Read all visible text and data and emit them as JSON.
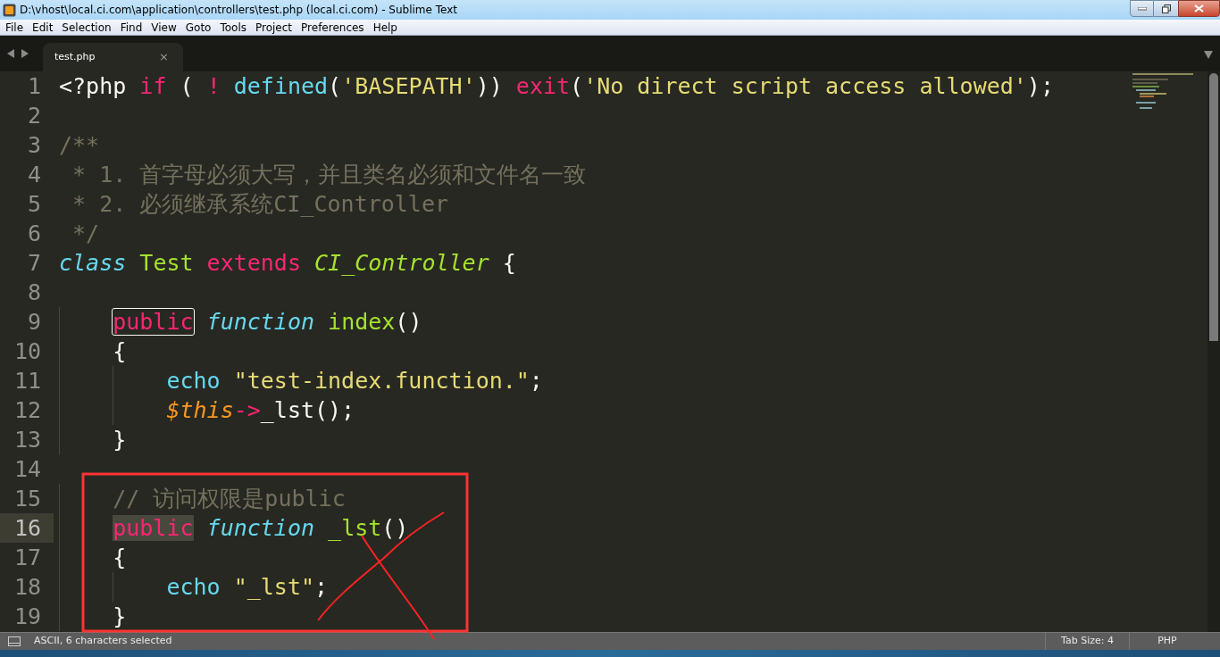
{
  "window": {
    "title": "D:\\vhost\\local.ci.com\\application\\controllers\\test.php (local.ci.com) - Sublime Text"
  },
  "menu": [
    "File",
    "Edit",
    "Selection",
    "Find",
    "View",
    "Goto",
    "Tools",
    "Project",
    "Preferences",
    "Help"
  ],
  "tabs": [
    {
      "label": "test.php",
      "selected": true,
      "close": "×"
    }
  ],
  "lines": [
    {
      "number": "1",
      "current": false,
      "tokens": [
        {
          "text": "<?php",
          "kind": "plain"
        },
        {
          "text": " if",
          "kind": "keyword"
        },
        {
          "text": " (",
          "kind": "plain"
        },
        {
          "text": " !",
          "kind": "keyword"
        },
        {
          "text": " defined",
          "kind": "builtin"
        },
        {
          "text": "(",
          "kind": "plain"
        },
        {
          "text": "'BASEPATH'",
          "kind": "string"
        },
        {
          "text": "))",
          "kind": "plain"
        },
        {
          "text": " exit",
          "kind": "keyword"
        },
        {
          "text": "(",
          "kind": "plain"
        },
        {
          "text": "'No direct script access allowed'",
          "kind": "string"
        },
        {
          "text": ");",
          "kind": "plain"
        }
      ]
    },
    {
      "number": "2",
      "current": false
    },
    {
      "number": "3",
      "current": false,
      "tokens": [
        {
          "text": "/**",
          "kind": "comment"
        }
      ]
    },
    {
      "number": "4",
      "current": false,
      "tokens": [
        {
          "text": " * 1. 首字母必须大写，并且类名必须和文件名一致",
          "kind": "comment"
        }
      ]
    },
    {
      "number": "5",
      "current": false,
      "tokens": [
        {
          "text": " * 2. 必须继承系统CI_Controller",
          "kind": "comment"
        }
      ]
    },
    {
      "number": "6",
      "current": false,
      "tokens": [
        {
          "text": " */",
          "kind": "comment"
        }
      ]
    },
    {
      "number": "7",
      "current": false,
      "tokens": [
        {
          "text": "class",
          "kind": "storage"
        },
        {
          "text": " Test",
          "kind": "entity"
        },
        {
          "text": " extends",
          "kind": "keyword"
        },
        {
          "text": " CI_Controller",
          "kind": "inherited"
        },
        {
          "text": " {",
          "kind": "plain"
        }
      ]
    },
    {
      "number": "8",
      "current": false
    },
    {
      "number": "9",
      "current": false,
      "tokens": [
        {
          "text": "    public",
          "kind": "keyword",
          "selected": false,
          "outlined": true
        },
        {
          "text": " function",
          "kind": "storage"
        },
        {
          "text": " index",
          "kind": "entity"
        },
        {
          "text": "()",
          "kind": "plain"
        }
      ]
    },
    {
      "number": "10",
      "current": false,
      "tokens": [
        {
          "text": "    {",
          "kind": "plain"
        }
      ]
    },
    {
      "number": "11",
      "current": false,
      "tokens": [
        {
          "text": "        echo",
          "kind": "builtin"
        },
        {
          "text": " \"test-index.function.\"",
          "kind": "string"
        },
        {
          "text": ";",
          "kind": "plain"
        }
      ]
    },
    {
      "number": "12",
      "current": false,
      "tokens": [
        {
          "text": "        $this",
          "kind": "variable"
        },
        {
          "text": "->",
          "kind": "keyword"
        },
        {
          "text": "_lst",
          "kind": "plain"
        },
        {
          "text": "();",
          "kind": "plain"
        }
      ]
    },
    {
      "number": "13",
      "current": false,
      "tokens": [
        {
          "text": "    }",
          "kind": "plain"
        }
      ]
    },
    {
      "number": "14",
      "current": false
    },
    {
      "number": "15",
      "current": false,
      "tokens": [
        {
          "text": "    // 访问权限是public",
          "kind": "comment"
        }
      ]
    },
    {
      "number": "16",
      "current": true,
      "tokens": [
        {
          "text": "    public",
          "kind": "keyword",
          "selected": true,
          "outlined": false
        },
        {
          "text": " function",
          "kind": "storage"
        },
        {
          "text": " _lst",
          "kind": "entity"
        },
        {
          "text": "()",
          "kind": "plain"
        }
      ]
    },
    {
      "number": "17",
      "current": false,
      "tokens": [
        {
          "text": "    {",
          "kind": "plain"
        }
      ]
    },
    {
      "number": "18",
      "current": false,
      "tokens": [
        {
          "text": "        echo",
          "kind": "builtin"
        },
        {
          "text": " \"_lst\"",
          "kind": "string"
        },
        {
          "text": ";",
          "kind": "plain"
        }
      ]
    },
    {
      "number": "19",
      "current": false,
      "tokens": [
        {
          "text": "    }",
          "kind": "plain"
        }
      ]
    }
  ],
  "status_bar": {
    "message": "ASCII, 6 characters selected",
    "tab_size": "Tab Size: 4",
    "syntax": "PHP"
  }
}
